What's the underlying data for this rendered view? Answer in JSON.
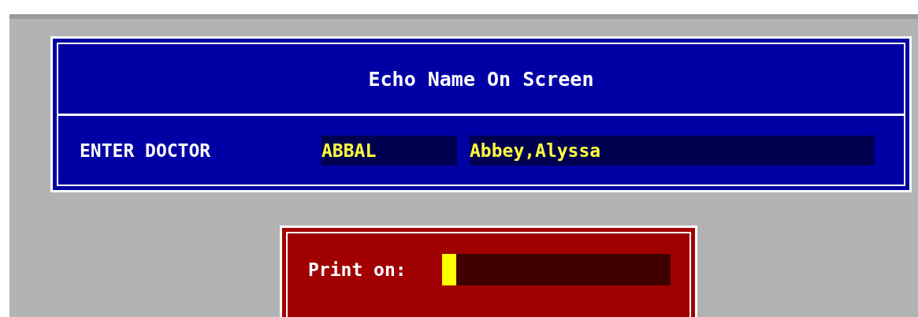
{
  "window": {
    "title": "Echo Name On Screen"
  },
  "doctor": {
    "label": "ENTER DOCTOR",
    "code": "ABBAL",
    "name": "Abbey,Alyssa"
  },
  "print_prompt": {
    "label": "Print on:",
    "focused": true
  }
}
